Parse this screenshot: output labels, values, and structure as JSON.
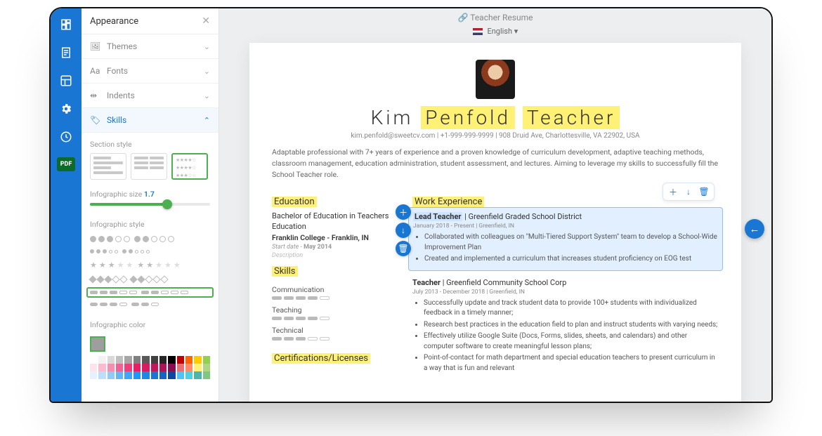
{
  "rail": {
    "items": [
      "design",
      "content",
      "sections",
      "settings",
      "history"
    ],
    "pdf_label": "PDF"
  },
  "panel": {
    "title": "Appearance",
    "accordion": {
      "themes": "Themes",
      "fonts": "Fonts",
      "indents": "Indents",
      "skills": "Skills"
    },
    "section_style_label": "Section style",
    "info_size_label": "Infographic size",
    "info_size_value": "1.7",
    "info_style_label": "Infographic style",
    "info_color_label": "Infographic color"
  },
  "header": {
    "doc_title": "Teacher Resume",
    "language": "English"
  },
  "resume": {
    "name_first": "Kim",
    "name_last": "Penfold",
    "role": "Teacher",
    "contact": "kim.penfold@sweetcv.com | +1-999-999-9999 | 908 Druid Ave, Charlottesville, VA 22902, USA",
    "summary": "Adaptable professional with 7+ years of experience and a proven knowledge of curriculum development, adaptive teaching methods, classroom management, education administration, student assessment, and lectures. Aiming to leverage my skills to successfully fill the School Teacher role.",
    "sections": {
      "education": "Education",
      "skills": "Skills",
      "certs": "Certifications/Licenses",
      "work": "Work Experience"
    },
    "education": {
      "degree": "Bachelor of Education in Teachers Education",
      "school": "Franklin College - Franklin, IN",
      "date_label": "Start date",
      "date_value": "May 2014",
      "description": "Description"
    },
    "skills": [
      {
        "name": "Communication",
        "level": 4
      },
      {
        "name": "Teaching",
        "level": 4
      },
      {
        "name": "Technical",
        "level": 3
      }
    ],
    "jobs": [
      {
        "role": "Lead Teacher",
        "company": "Greenfield Graded School District",
        "dates": "January 2018 - Present | Greenfield, IN",
        "bullets": [
          "Collaborated with colleagues on \"Multi-Tiered Support System\" team to develop a School-Wide Improvement Plan",
          "Created and implemented a curriculum that increases student proficiency on EOG test"
        ],
        "active": true
      },
      {
        "role": "Teacher",
        "company": "Greenfield Community School Corp",
        "dates": "July 2013 - December 2018 | Greenfield, IN",
        "bullets": [
          "Successfully update and track student data to provide 100+ students with individualized feedback in a timely manner;",
          "Research best practices in the education field to plan and instruct students with varying needs;",
          "Effectively utilize Google Suite (Docs, Forms, slides, sheets, and calendars) and other computer software to create meaningful lesson plans;",
          "Point-of-contact for math department and special education teachers to present curriculum in a way that is fun and relevant"
        ],
        "active": false
      }
    ]
  },
  "colors": {
    "rows": [
      [
        "#ffffff",
        "#f2f2f2",
        "#d9d9d9",
        "#bfbfbf",
        "#a6a6a6",
        "#808080",
        "#595959",
        "#404040",
        "#262626",
        "#000000",
        "#c00000",
        "#ff6600",
        "#ffcc00",
        "#92d050"
      ],
      [
        "#fce4ec",
        "#f8bbd0",
        "#f48fb1",
        "#f06292",
        "#ec407a",
        "#e91e63",
        "#d81b60",
        "#c2185b",
        "#ad1457",
        "#880e4f",
        "#e57373",
        "#ff8a65",
        "#fff176",
        "#aed581"
      ],
      [
        "#e3f2fd",
        "#bbdefb",
        "#90caf9",
        "#64b5f6",
        "#42a5f5",
        "#2196f3",
        "#1e88e5",
        "#1976d2",
        "#1565c0",
        "#0d47a1",
        "#4fc3f7",
        "#4dd0e1",
        "#4db6ac",
        "#81c784"
      ]
    ],
    "selected": "#9e9e9e"
  }
}
